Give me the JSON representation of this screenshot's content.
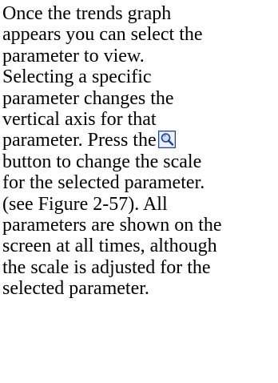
{
  "paragraph": {
    "lines": [
      "Once the trends graph",
      "appears you can select the",
      "parameter to view.",
      "Selecting a specific",
      "parameter changes the",
      "vertical axis for that",
      "parameter.  Press the",
      "button to change the scale",
      "for the selected parameter.",
      "(see Figure 2-57).  All",
      "parameters are shown on the",
      "screen at all times, although",
      "the scale is adjusted for the",
      "selected parameter."
    ]
  },
  "icons": {
    "zoom": "magnifier-zoom-icon"
  },
  "colors": {
    "text": "#000000",
    "background": "#ffffff",
    "icon_border": "#1f3f8f",
    "icon_lens": "#5a8fd6"
  }
}
